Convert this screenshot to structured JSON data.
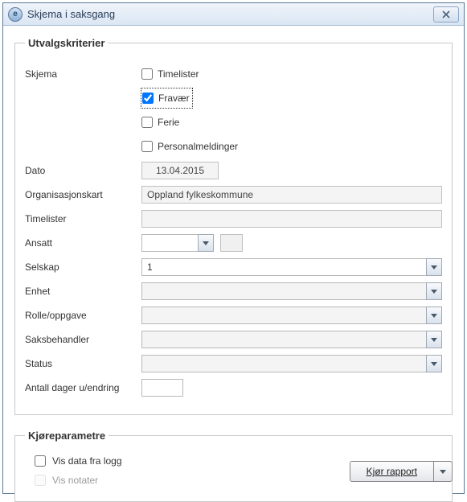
{
  "window": {
    "title": "Skjema i saksgang"
  },
  "utvalg": {
    "legend": "Utvalgskriterier",
    "labels": {
      "skjema": "Skjema",
      "dato": "Dato",
      "orgkart": "Organisasjonskart",
      "timelister": "Timelister",
      "ansatt": "Ansatt",
      "selskap": "Selskap",
      "enhet": "Enhet",
      "rolle": "Rolle/oppgave",
      "saksbehandler": "Saksbehandler",
      "status": "Status",
      "antall": "Antall dager u/endring"
    },
    "skjema_options": {
      "timelister": {
        "label": "Timelister",
        "checked": false
      },
      "fravaer": {
        "label": "Fravær",
        "checked": true
      },
      "ferie": {
        "label": "Ferie",
        "checked": false
      },
      "personal": {
        "label": "Personalmeldinger",
        "checked": false
      }
    },
    "values": {
      "dato": "13.04.2015",
      "orgkart": "Oppland fylkeskommune",
      "timelister": "",
      "ansatt": "",
      "selskap": "1",
      "enhet": "",
      "rolle": "",
      "saksbehandler": "",
      "status": "",
      "antall": ""
    }
  },
  "params": {
    "legend": "Kjøreparametre",
    "vis_logg": {
      "label": "Vis data fra logg",
      "checked": false,
      "enabled": true
    },
    "vis_notater": {
      "label": "Vis notater",
      "checked": false,
      "enabled": false
    }
  },
  "actions": {
    "run": "Kjør rapport"
  }
}
